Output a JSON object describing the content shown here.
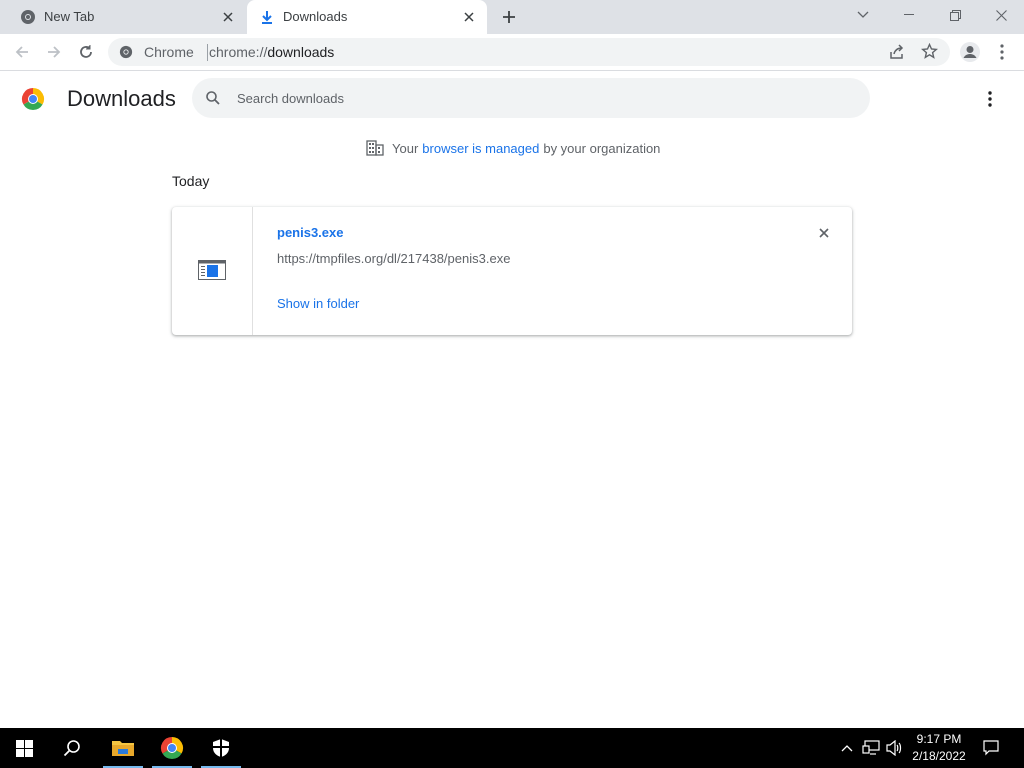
{
  "tabs": [
    {
      "title": "New Tab",
      "icon": "chrome-icon",
      "active": false
    },
    {
      "title": "Downloads",
      "icon": "download-icon",
      "active": true
    }
  ],
  "toolbar": {
    "site_label": "Chrome",
    "url_prefix": "chrome://",
    "url_path": "downloads"
  },
  "page": {
    "title": "Downloads",
    "search_placeholder": "Search downloads",
    "managed_notice": {
      "before": "Your",
      "link": "browser is managed",
      "after": "by your organization"
    },
    "sections": [
      {
        "heading": "Today",
        "items": [
          {
            "file_name": "penis3.exe",
            "url": "https://tmpfiles.org/dl/217438/penis3.exe",
            "action": "Show in folder"
          }
        ]
      }
    ]
  },
  "taskbar": {
    "apps": [
      "windows-start-icon",
      "search-icon",
      "file-explorer-icon",
      "chrome-icon",
      "windows-security-icon"
    ],
    "time": "9:17 PM",
    "date": "2/18/2022"
  },
  "colors": {
    "accent": "#1a73e8",
    "tabstrip": "#dee1e6",
    "taskbar": "#000000"
  }
}
